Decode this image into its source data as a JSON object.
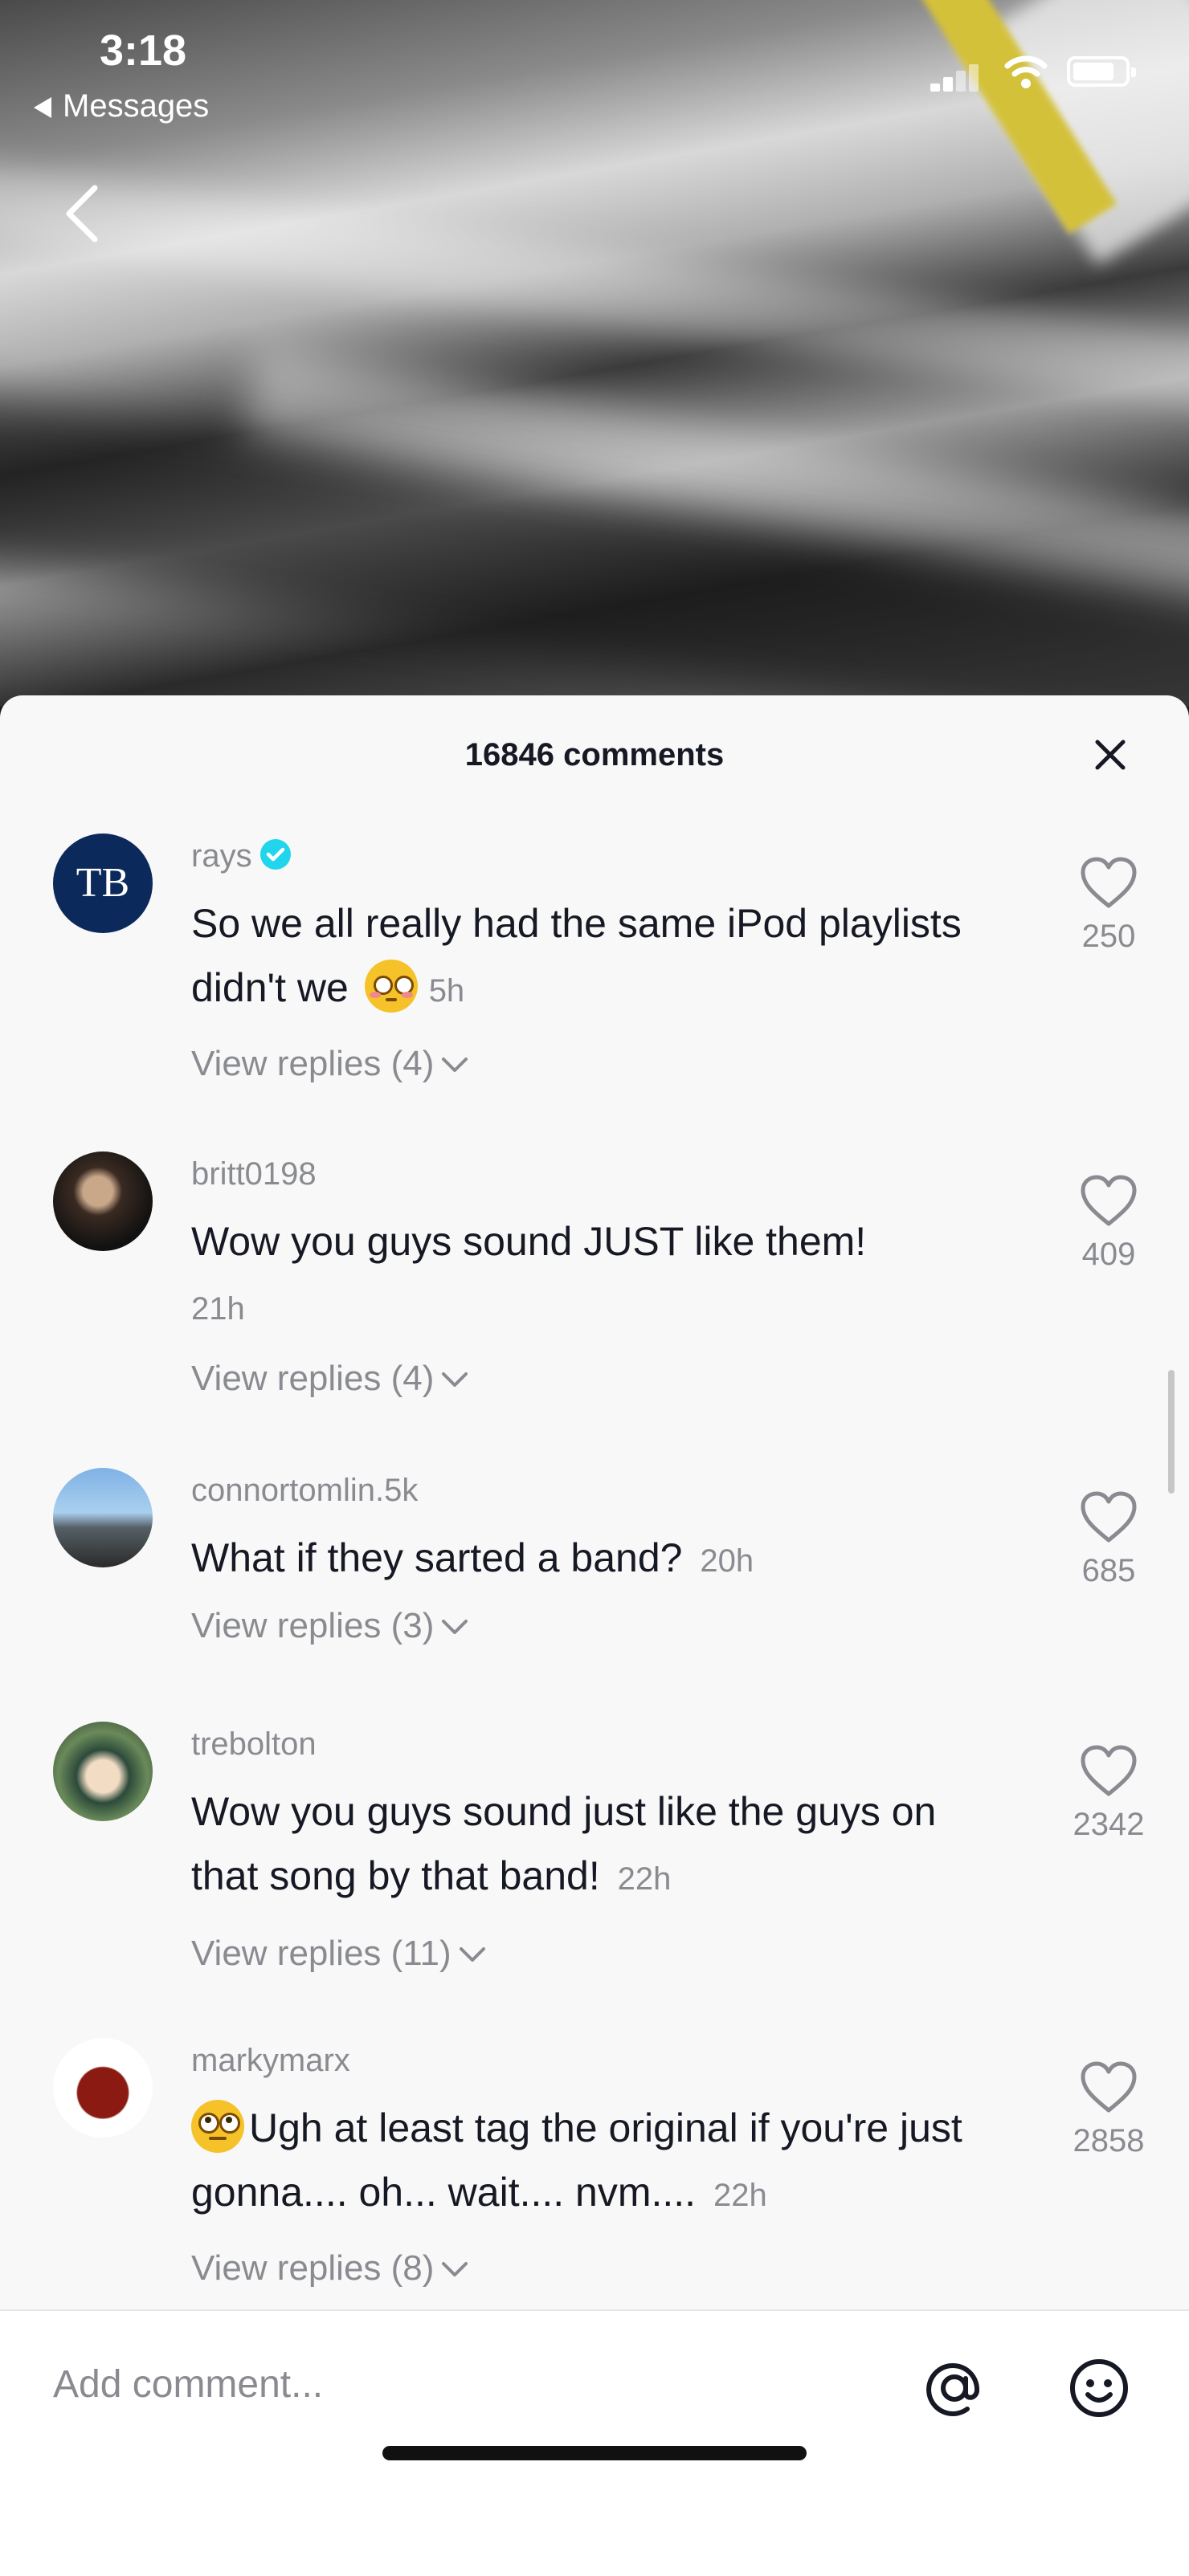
{
  "status_bar": {
    "time": "3:18",
    "back_app": "Messages"
  },
  "sheet": {
    "title": "16846 comments",
    "close_icon": "close-icon"
  },
  "comments": [
    {
      "username": "rays",
      "verified": true,
      "avatar_text": "TB",
      "text": "So we all really had the same iPod playlists didn't we",
      "emoji": "flushed-face",
      "time": "5h",
      "replies": "View replies (4)",
      "likes": "250"
    },
    {
      "username": "britt0198",
      "verified": false,
      "text": "Wow you guys sound JUST like them!",
      "time": "21h",
      "replies": "View replies (4)",
      "likes": "409"
    },
    {
      "username": "connortomlin.5k",
      "verified": false,
      "text": "What if they sarted a band?",
      "time": "20h",
      "replies": "View replies (3)",
      "likes": "685"
    },
    {
      "username": "trebolton",
      "verified": false,
      "text": "Wow you guys sound just like the guys on that song by that band!",
      "time": "22h",
      "replies": "View replies (11)",
      "likes": "2342"
    },
    {
      "username": "markymarx",
      "verified": false,
      "emoji": "face-with-rolling-eyes",
      "text": "Ugh at least tag the original if you're just gonna.... oh... wait.... nvm....",
      "time": "22h",
      "replies": "View replies (8)",
      "likes": "2858"
    }
  ],
  "input": {
    "placeholder": "Add comment...",
    "mention_icon": "at-icon",
    "emoji_icon": "emoji-icon"
  },
  "colors": {
    "sheet_bg": "#f8f8f8",
    "text": "#161823",
    "muted": "#8a8b91",
    "verified": "#20d5ec"
  }
}
